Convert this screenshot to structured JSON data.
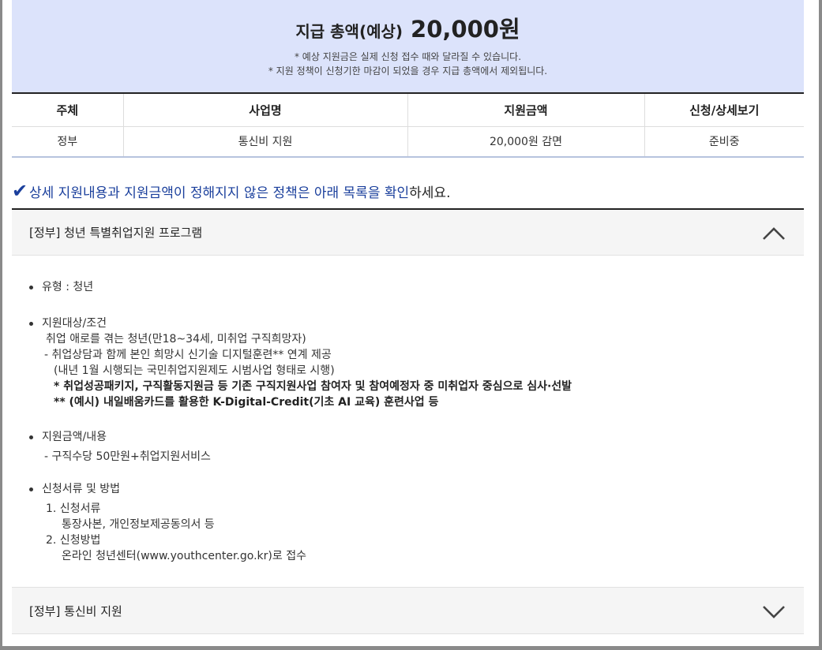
{
  "summary": {
    "label": "지급 총액(예상)",
    "amount": "20,000원",
    "notes": [
      "* 예상 지원금은 실제 신청 접수 때와 달라질 수 있습니다.",
      "* 지원 정책이 신청기한 마감이 되었을 경우 지급 총액에서 제외됩니다."
    ]
  },
  "table": {
    "headers": [
      "주체",
      "사업명",
      "지원금액",
      "신청/상세보기"
    ],
    "rows": [
      [
        "정부",
        "통신비 지원",
        "20,000원 감면",
        "준비중"
      ]
    ]
  },
  "notice": {
    "prefix": "상세 지원내용과 지원금액이 정해지지 않은 정책은 아래 목록을 확인",
    "suffix": "하세요."
  },
  "accordion": [
    {
      "title": "[정부] 청년 특별취업지원 프로그램",
      "expanded": true,
      "icon": "chevron-up-icon",
      "sections": [
        {
          "heading": "유형 : 청년",
          "lines": []
        },
        {
          "heading": "지원대상/조건",
          "lines": [
            "취업 애로를 겪는 청년(만18~34세, 미취업 구직희망자)",
            "- 취업상담과 함께 본인 희망시 신기술 디지털훈련** 연계 제공",
            "(내년 1월 시행되는 국민취업지원제도 시범사업 형태로 시행)",
            "* 취업성공패키지, 구직활동지원금 등 기존 구직지원사업 참여자 및 참여예정자 중 미취업자 중심으로 심사·선발",
            "** (예시) 내일배움카드를 활용한 K-Digital-Credit(기초 AI 교육) 훈련사업 등"
          ]
        },
        {
          "heading": "지원금액/내용",
          "lines": [
            "- 구직수당 50만원+취업지원서비스"
          ]
        },
        {
          "heading": "신청서류 및 방법",
          "lines": [
            "1. 신청서류",
            "통장사본, 개인정보제공동의서 등",
            "2. 신청방법",
            "온라인 청년센터(www.youthcenter.go.kr)로 접수"
          ]
        }
      ]
    },
    {
      "title": "[정부] 통신비 지원",
      "expanded": false,
      "icon": "chevron-down-icon"
    }
  ],
  "colors": {
    "summary_bg": "#dce3fb",
    "accent": "#1a3f9c",
    "header_bg": "#f5f5f5"
  }
}
